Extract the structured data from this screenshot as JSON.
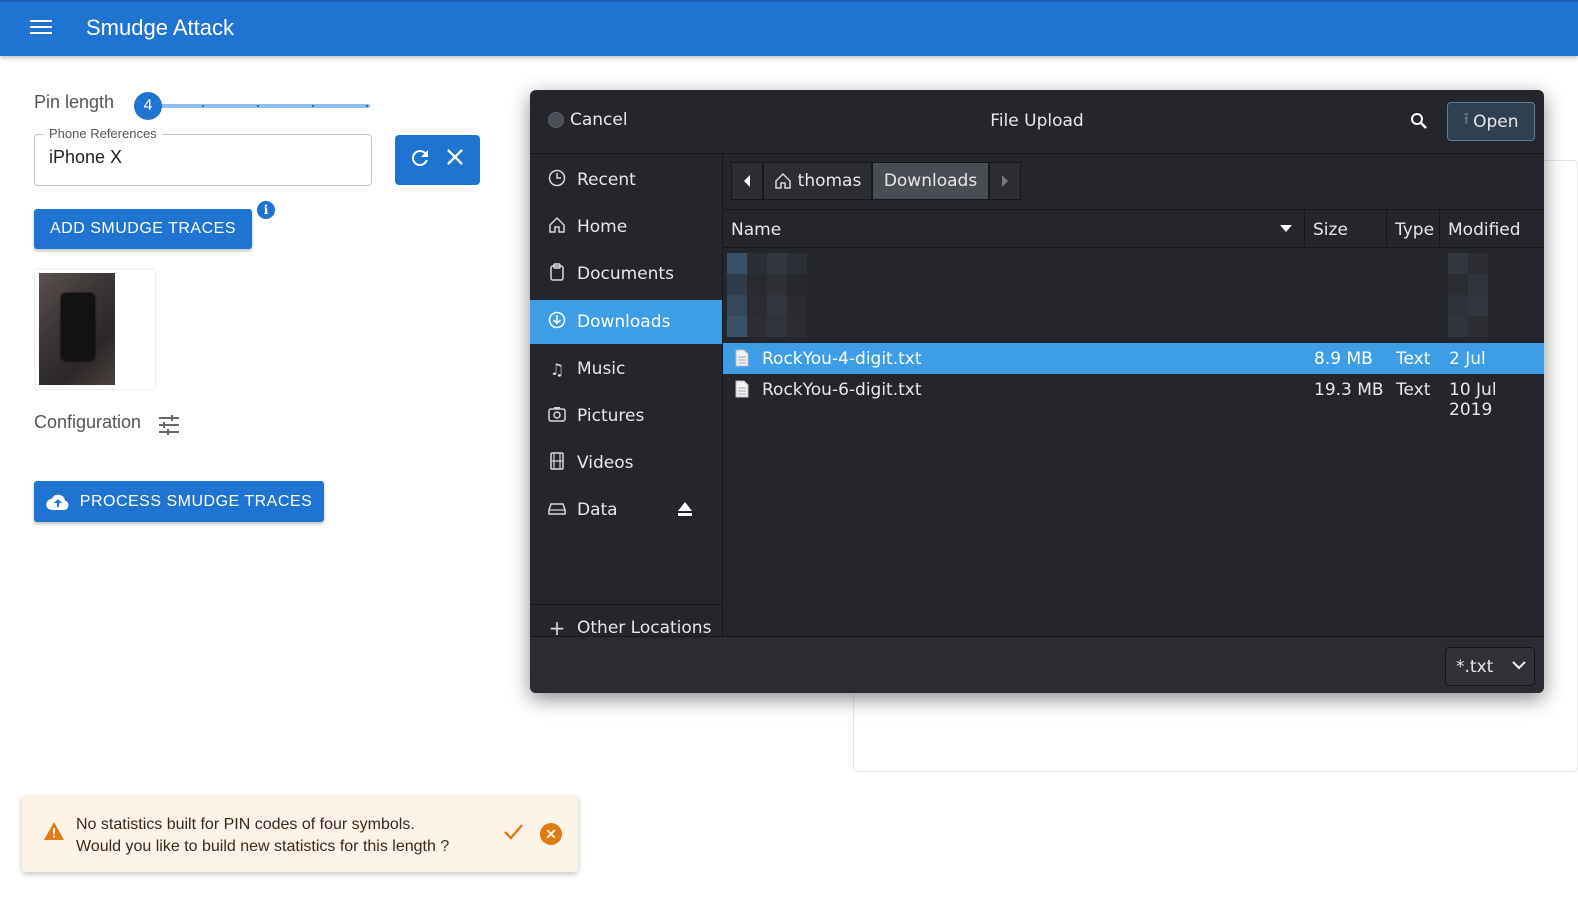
{
  "app": {
    "title": "Smudge Attack"
  },
  "form": {
    "pin_label": "Pin length",
    "pin_value": "4",
    "phone_legend": "Phone References",
    "phone_value": "iPhone X",
    "add_button": "ADD SMUDGE TRACES",
    "info_symbol": "i",
    "config_label": "Configuration",
    "process_button": "PROCESS SMUDGE TRACES"
  },
  "snackbar": {
    "line1": "No statistics built for PIN codes of four symbols.",
    "line2": "Would you like to build new statistics for this length ?"
  },
  "dialog": {
    "title": "File Upload",
    "cancel": "Cancel",
    "open": "Open",
    "sidebar": [
      {
        "label": "Recent",
        "icon": "clock-icon"
      },
      {
        "label": "Home",
        "icon": "home-icon"
      },
      {
        "label": "Documents",
        "icon": "documents-icon"
      },
      {
        "label": "Downloads",
        "icon": "download-icon",
        "selected": true
      },
      {
        "label": "Music",
        "icon": "music-icon"
      },
      {
        "label": "Pictures",
        "icon": "camera-icon"
      },
      {
        "label": "Videos",
        "icon": "film-icon"
      },
      {
        "label": "Data",
        "icon": "drive-icon"
      }
    ],
    "other_locations": "Other Locations",
    "path": [
      "thomas",
      "Downloads"
    ],
    "columns": {
      "name": "Name",
      "size": "Size",
      "type": "Type",
      "modified": "Modified"
    },
    "files": [
      {
        "name": "RockYou-4-digit.txt",
        "size": "8.9 MB",
        "type": "Text",
        "modified": "2 Jul",
        "selected": true
      },
      {
        "name": "RockYou-6-digit.txt",
        "size": "19.3 MB",
        "type": "Text",
        "modified": "10 Jul 2019"
      }
    ],
    "filter": "*.txt"
  },
  "colors": {
    "primary": "#1f74d2",
    "dialog_bg": "#24262b",
    "selection": "#3d9ee6",
    "warning": "#e07a12"
  }
}
